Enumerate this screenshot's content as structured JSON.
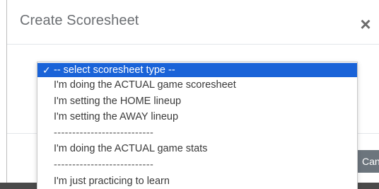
{
  "modal": {
    "title": "Create Scoresheet",
    "close_label": "×",
    "cancel_label": "Cancel"
  },
  "dropdown": {
    "selected_check": "✓",
    "options": [
      {
        "label": "-- select scoresheet type --",
        "selected": true
      },
      {
        "label": "I'm doing the ACTUAL game scoresheet",
        "selected": false
      },
      {
        "label": "I'm setting the HOME lineup",
        "selected": false
      },
      {
        "label": "I'm setting the AWAY lineup",
        "selected": false
      },
      {
        "label": "---------------------------",
        "selected": false
      },
      {
        "label": "I'm doing the ACTUAL game stats",
        "selected": false
      },
      {
        "label": "---------------------------",
        "selected": false
      },
      {
        "label": "I'm just practicing to learn",
        "selected": false
      }
    ]
  },
  "colors": {
    "selected_bg": "#1a63d8",
    "cancel_bg": "#6c757d"
  }
}
